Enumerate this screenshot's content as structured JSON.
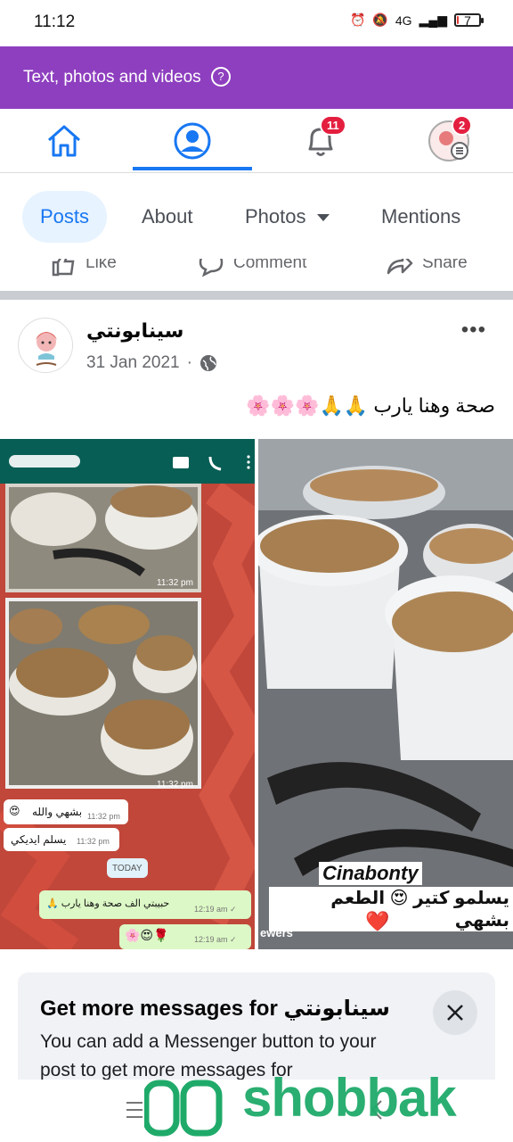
{
  "status_bar": {
    "time": "11:12",
    "network": "4G",
    "battery": "7",
    "battery_level": 0.07
  },
  "banner": {
    "text": "Text, photos and videos",
    "help_glyph": "?"
  },
  "nav": {
    "notifications_badge": "11",
    "menu_badge": "2",
    "active": "profile"
  },
  "tabs": [
    {
      "label": "Posts",
      "active": true
    },
    {
      "label": "About"
    },
    {
      "label": "Photos"
    },
    {
      "label": "Mentions"
    }
  ],
  "actions": {
    "like": "Like",
    "comment": "Comment",
    "share": "Share"
  },
  "post": {
    "author": "سينابونتي",
    "date": "31 Jan 2021",
    "separator": "·",
    "more": "•••",
    "text": "صحة وهنا يارب 🙏🙏🌸🌸🌸"
  },
  "left_image": {
    "time_1": "11:32 pm",
    "time_2": "11:32 pm",
    "msg_1": "بشهي والله",
    "msg_1_time": "11:32 pm",
    "msg_2": "يسلم ايديكي",
    "msg_2_time": "11:32 pm",
    "today": "TODAY",
    "msg_3": "حبيبتي الف صحة وهنا يارب 🙏",
    "msg_3_time": "12:19 am ✓",
    "msg_4_time": "12:19 am ✓"
  },
  "right_image": {
    "brand": "Cinabonty",
    "caption": "يسلمو كتير 😍 الطعم بشهي",
    "viewers": "ewers"
  },
  "card": {
    "title": "Get more messages for سينابونتي",
    "body": "You can add a Messenger button to your post to get more messages for"
  },
  "watermark": "shobbak",
  "colors": {
    "brand_purple": "#8e3fbf",
    "fb_blue": "#1877f2",
    "badge_red": "#e41e3f",
    "watermark_green": "#1faa6a"
  }
}
